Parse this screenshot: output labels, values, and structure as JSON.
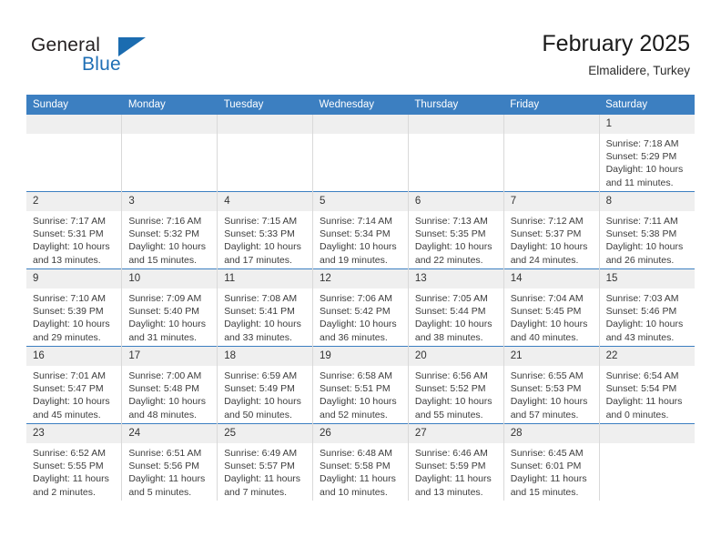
{
  "brand": {
    "word_one": "General",
    "word_two": "Blue",
    "mark": "blue-triangle-icon"
  },
  "header": {
    "title": "February 2025",
    "subtitle": "Elmalidere, Turkey"
  },
  "colors": {
    "accent": "#3c7fc1",
    "brand_blue": "#1f6fb5",
    "daynum_band": "#efefef",
    "cell_border": "#d9d9d9",
    "text": "#3c3c3c"
  },
  "calendar": {
    "weekday_headers": [
      "Sunday",
      "Monday",
      "Tuesday",
      "Wednesday",
      "Thursday",
      "Friday",
      "Saturday"
    ],
    "weeks": [
      [
        {
          "day": "",
          "lines": []
        },
        {
          "day": "",
          "lines": []
        },
        {
          "day": "",
          "lines": []
        },
        {
          "day": "",
          "lines": []
        },
        {
          "day": "",
          "lines": []
        },
        {
          "day": "",
          "lines": []
        },
        {
          "day": "1",
          "lines": [
            "Sunrise: 7:18 AM",
            "Sunset: 5:29 PM",
            "Daylight: 10 hours",
            "and 11 minutes."
          ]
        }
      ],
      [
        {
          "day": "2",
          "lines": [
            "Sunrise: 7:17 AM",
            "Sunset: 5:31 PM",
            "Daylight: 10 hours",
            "and 13 minutes."
          ]
        },
        {
          "day": "3",
          "lines": [
            "Sunrise: 7:16 AM",
            "Sunset: 5:32 PM",
            "Daylight: 10 hours",
            "and 15 minutes."
          ]
        },
        {
          "day": "4",
          "lines": [
            "Sunrise: 7:15 AM",
            "Sunset: 5:33 PM",
            "Daylight: 10 hours",
            "and 17 minutes."
          ]
        },
        {
          "day": "5",
          "lines": [
            "Sunrise: 7:14 AM",
            "Sunset: 5:34 PM",
            "Daylight: 10 hours",
            "and 19 minutes."
          ]
        },
        {
          "day": "6",
          "lines": [
            "Sunrise: 7:13 AM",
            "Sunset: 5:35 PM",
            "Daylight: 10 hours",
            "and 22 minutes."
          ]
        },
        {
          "day": "7",
          "lines": [
            "Sunrise: 7:12 AM",
            "Sunset: 5:37 PM",
            "Daylight: 10 hours",
            "and 24 minutes."
          ]
        },
        {
          "day": "8",
          "lines": [
            "Sunrise: 7:11 AM",
            "Sunset: 5:38 PM",
            "Daylight: 10 hours",
            "and 26 minutes."
          ]
        }
      ],
      [
        {
          "day": "9",
          "lines": [
            "Sunrise: 7:10 AM",
            "Sunset: 5:39 PM",
            "Daylight: 10 hours",
            "and 29 minutes."
          ]
        },
        {
          "day": "10",
          "lines": [
            "Sunrise: 7:09 AM",
            "Sunset: 5:40 PM",
            "Daylight: 10 hours",
            "and 31 minutes."
          ]
        },
        {
          "day": "11",
          "lines": [
            "Sunrise: 7:08 AM",
            "Sunset: 5:41 PM",
            "Daylight: 10 hours",
            "and 33 minutes."
          ]
        },
        {
          "day": "12",
          "lines": [
            "Sunrise: 7:06 AM",
            "Sunset: 5:42 PM",
            "Daylight: 10 hours",
            "and 36 minutes."
          ]
        },
        {
          "day": "13",
          "lines": [
            "Sunrise: 7:05 AM",
            "Sunset: 5:44 PM",
            "Daylight: 10 hours",
            "and 38 minutes."
          ]
        },
        {
          "day": "14",
          "lines": [
            "Sunrise: 7:04 AM",
            "Sunset: 5:45 PM",
            "Daylight: 10 hours",
            "and 40 minutes."
          ]
        },
        {
          "day": "15",
          "lines": [
            "Sunrise: 7:03 AM",
            "Sunset: 5:46 PM",
            "Daylight: 10 hours",
            "and 43 minutes."
          ]
        }
      ],
      [
        {
          "day": "16",
          "lines": [
            "Sunrise: 7:01 AM",
            "Sunset: 5:47 PM",
            "Daylight: 10 hours",
            "and 45 minutes."
          ]
        },
        {
          "day": "17",
          "lines": [
            "Sunrise: 7:00 AM",
            "Sunset: 5:48 PM",
            "Daylight: 10 hours",
            "and 48 minutes."
          ]
        },
        {
          "day": "18",
          "lines": [
            "Sunrise: 6:59 AM",
            "Sunset: 5:49 PM",
            "Daylight: 10 hours",
            "and 50 minutes."
          ]
        },
        {
          "day": "19",
          "lines": [
            "Sunrise: 6:58 AM",
            "Sunset: 5:51 PM",
            "Daylight: 10 hours",
            "and 52 minutes."
          ]
        },
        {
          "day": "20",
          "lines": [
            "Sunrise: 6:56 AM",
            "Sunset: 5:52 PM",
            "Daylight: 10 hours",
            "and 55 minutes."
          ]
        },
        {
          "day": "21",
          "lines": [
            "Sunrise: 6:55 AM",
            "Sunset: 5:53 PM",
            "Daylight: 10 hours",
            "and 57 minutes."
          ]
        },
        {
          "day": "22",
          "lines": [
            "Sunrise: 6:54 AM",
            "Sunset: 5:54 PM",
            "Daylight: 11 hours",
            "and 0 minutes."
          ]
        }
      ],
      [
        {
          "day": "23",
          "lines": [
            "Sunrise: 6:52 AM",
            "Sunset: 5:55 PM",
            "Daylight: 11 hours",
            "and 2 minutes."
          ]
        },
        {
          "day": "24",
          "lines": [
            "Sunrise: 6:51 AM",
            "Sunset: 5:56 PM",
            "Daylight: 11 hours",
            "and 5 minutes."
          ]
        },
        {
          "day": "25",
          "lines": [
            "Sunrise: 6:49 AM",
            "Sunset: 5:57 PM",
            "Daylight: 11 hours",
            "and 7 minutes."
          ]
        },
        {
          "day": "26",
          "lines": [
            "Sunrise: 6:48 AM",
            "Sunset: 5:58 PM",
            "Daylight: 11 hours",
            "and 10 minutes."
          ]
        },
        {
          "day": "27",
          "lines": [
            "Sunrise: 6:46 AM",
            "Sunset: 5:59 PM",
            "Daylight: 11 hours",
            "and 13 minutes."
          ]
        },
        {
          "day": "28",
          "lines": [
            "Sunrise: 6:45 AM",
            "Sunset: 6:01 PM",
            "Daylight: 11 hours",
            "and 15 minutes."
          ]
        },
        {
          "day": "",
          "lines": []
        }
      ]
    ]
  }
}
